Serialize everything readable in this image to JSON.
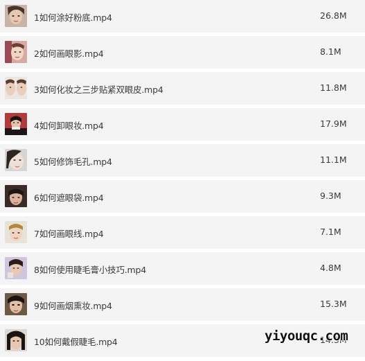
{
  "files": [
    {
      "name": "1如何涂好粉底.mp4",
      "size": "26.8M",
      "thumb": "face-thumbnail-icon"
    },
    {
      "name": "2如何画眼影.mp4",
      "size": "8.1M",
      "thumb": "face-thumbnail-icon"
    },
    {
      "name": "3如何化妆之三步贴紧双眼皮.mp4",
      "size": "11.8M",
      "thumb": "face-thumbnail-icon"
    },
    {
      "name": "4如何卸眼妆.mp4",
      "size": "17.9M",
      "thumb": "face-thumbnail-icon"
    },
    {
      "name": "5如何修饰毛孔.mp4",
      "size": "11.1M",
      "thumb": "face-thumbnail-icon"
    },
    {
      "name": "6如何遮眼袋.mp4",
      "size": "9.3M",
      "thumb": "face-thumbnail-icon"
    },
    {
      "name": "7如何画眼线.mp4",
      "size": "7.1M",
      "thumb": "face-thumbnail-icon"
    },
    {
      "name": "8如何使用睫毛膏小技巧.mp4",
      "size": "4.8M",
      "thumb": "face-thumbnail-icon"
    },
    {
      "name": "9如何画烟熏妆.mp4",
      "size": "15.3M",
      "thumb": "face-thumbnail-icon"
    },
    {
      "name": "10如何戴假睫毛.mp4",
      "size": "14.3M",
      "thumb": "face-thumbnail-icon"
    }
  ],
  "watermark": "yiyouqc.com"
}
